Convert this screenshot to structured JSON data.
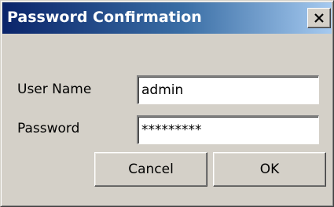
{
  "window": {
    "title": "Password Confirmation",
    "close_icon": "close-x-icon"
  },
  "form": {
    "username_label": "User Name",
    "username_value": "admin",
    "password_label": "Password",
    "password_value": "*********"
  },
  "buttons": {
    "cancel_label": "Cancel",
    "ok_label": "OK"
  },
  "colors": {
    "titlebar_start": "#0a246a",
    "titlebar_end": "#a6caf0",
    "dialog_face": "#d4d0c8"
  }
}
